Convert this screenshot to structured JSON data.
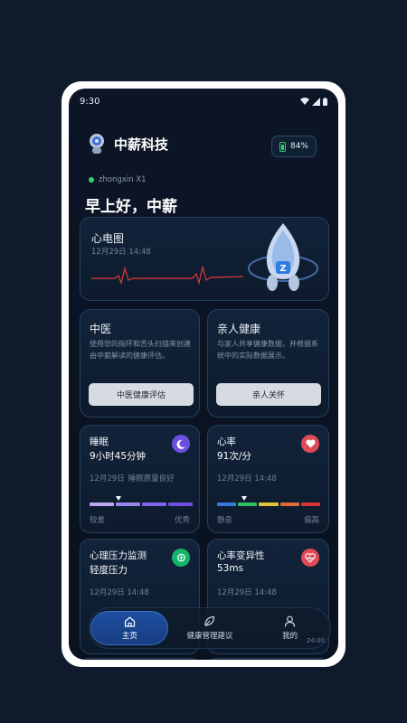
{
  "status_bar": {
    "time": "9:30"
  },
  "header": {
    "app_title": "中薪科技",
    "battery": "84%"
  },
  "device": {
    "name": "zhongxin X1"
  },
  "greeting": "早上好，中薪",
  "ecg_card": {
    "title": "心电图",
    "time": "12月29日 14:48"
  },
  "tcm_card": {
    "title": "中医",
    "description": "使用您的指环和舌头扫描来创建由中薪解读的健康评估。",
    "button": "中医健康评估"
  },
  "family_card": {
    "title": "亲人健康",
    "description": "与家人共享健康数据，并根据系统中的实际数据展示。",
    "button": "亲人关怀"
  },
  "sleep_card": {
    "title": "睡眠",
    "value": "9小时45分钟",
    "time": "12月29日",
    "status": "睡眠质量良好",
    "scale_left": "较差",
    "scale_right": "优秀",
    "level": 0.37
  },
  "heart_card": {
    "title": "心率",
    "value": "91次/分",
    "time": "12月29日 14:48",
    "scale_left": "静息",
    "scale_right": "偏高",
    "level": 0.3
  },
  "stress_card": {
    "title": "心理压力监测",
    "value": "轻度压力",
    "time": "12月29日 14:48"
  },
  "hrv_card": {
    "title": "心率变异性",
    "value": "53ms",
    "time": "12月29日 14:48"
  },
  "tabbar": {
    "home": "主页",
    "advice": "健康管理建议",
    "mine": "我的",
    "trailing_time": "24:00"
  },
  "colors": {
    "accent": "#1f4fa0",
    "sleep_badge": "#6c4ee0",
    "heart_badge": "#e04a57",
    "stress_badge": "#17b36b",
    "hrv_badge": "#e04a57"
  }
}
